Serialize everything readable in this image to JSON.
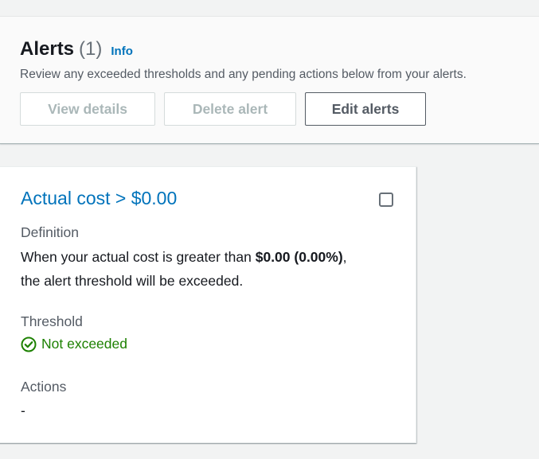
{
  "header": {
    "title": "Alerts",
    "count": "(1)",
    "info_label": "Info",
    "description": "Review any exceeded thresholds and any pending actions below from your alerts.",
    "buttons": {
      "view_details": "View details",
      "delete_alert": "Delete alert",
      "edit_alerts": "Edit alerts"
    }
  },
  "alert_card": {
    "title": "Actual cost > $0.00",
    "definition_label": "Definition",
    "definition_prefix": "When your actual cost is greater than ",
    "definition_amount": "$0.00 (0.00%)",
    "definition_suffix": ",",
    "definition_line2": "the alert threshold will be exceeded.",
    "threshold_label": "Threshold",
    "threshold_status": "Not exceeded",
    "status_icon": "check-circle-icon",
    "actions_label": "Actions",
    "actions_value": "-"
  },
  "colors": {
    "link": "#0073bb",
    "success": "#1d8102",
    "disabled": "#aab7b8"
  }
}
